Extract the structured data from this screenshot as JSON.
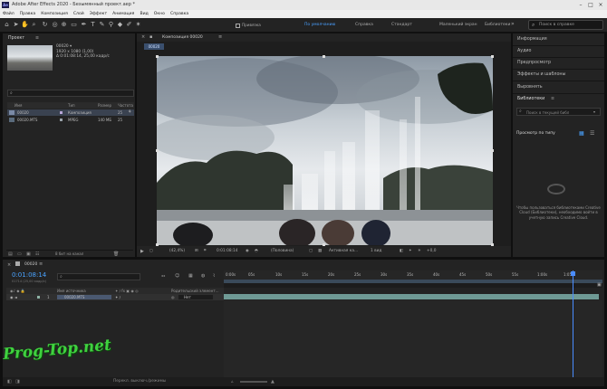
{
  "titlebar": {
    "app_logo": "Ae",
    "title": "Adobe After Effects 2020 - Безымянный проект.aep *"
  },
  "menu": [
    "Файл",
    "Правка",
    "Композиция",
    "Слой",
    "Эффект",
    "Анимация",
    "Вид",
    "Окно",
    "Справка"
  ],
  "toolbar": {
    "snap_label": "Привязка",
    "workspaces": [
      {
        "label": "По умолчанию",
        "active": true
      },
      {
        "label": "Справка",
        "active": false
      },
      {
        "label": "Стандарт",
        "active": false
      },
      {
        "label": "Маленький экран",
        "active": false
      },
      {
        "label": "Библиотеки",
        "active": false
      }
    ],
    "search_placeholder": "Поиск в справке"
  },
  "project": {
    "title": "Проект",
    "item_name": "00020 ▾",
    "item_dims": "1920 x 1080 (1,00)",
    "item_duration": "Δ 0:01:08:14, 25,00 кадр/с",
    "columns": {
      "name": "Имя",
      "type": "Тип",
      "size": "Размер",
      "rate": "Частота"
    },
    "rows": [
      {
        "name": "00020",
        "type": "Композиция",
        "size": "",
        "rate": "25",
        "selected": true
      },
      {
        "name": "00020.MTS",
        "type": "MPEG",
        "size": "140 МБ",
        "rate": "25",
        "selected": false
      }
    ],
    "bpc": "8 бит на канал"
  },
  "composition": {
    "panel_title": "Композиция 00020",
    "tab": "00020",
    "viewer_label": "00020"
  },
  "comp_controls": {
    "zoom": "(42,4%)",
    "timecode": "0:01:08:14",
    "resolution": "(Половина)",
    "camera": "Активная ка...",
    "views": "1 вид",
    "offset": "+0,0"
  },
  "right_panel": {
    "items": [
      "Информация",
      "Аудио",
      "Предпросмотр",
      "Эффекты и шаблоны",
      "Выровнять",
      "Библиотеки"
    ],
    "lib_search": "Поиск в текущей библ",
    "view_label": "Просмотр по типу",
    "cc_message": "Чтобы пользоваться библиотеками Creative Cloud (Библиотеки), необходимо войти в учетную запись Creative Cloud."
  },
  "timeline": {
    "tab": "00020",
    "timecode": "0:01:08:14",
    "timecode_sub": "01714 (25,00 кадр/с)",
    "col_source": "Имя источника",
    "col_parent": "Родительский элемент...",
    "layer_num": "1",
    "layer_name": "00020.MTS",
    "parent_value": "Нет",
    "ticks": [
      "0:00s",
      "05s",
      "10s",
      "15s",
      "20s",
      "25s",
      "30s",
      "35s",
      "40s",
      "45s",
      "50s",
      "55s",
      "1:00s",
      "1:05s"
    ],
    "playhead_fraction": 0.92,
    "status": "Перекл. выключ./режимы"
  },
  "watermark": "Prog-Top.net"
}
